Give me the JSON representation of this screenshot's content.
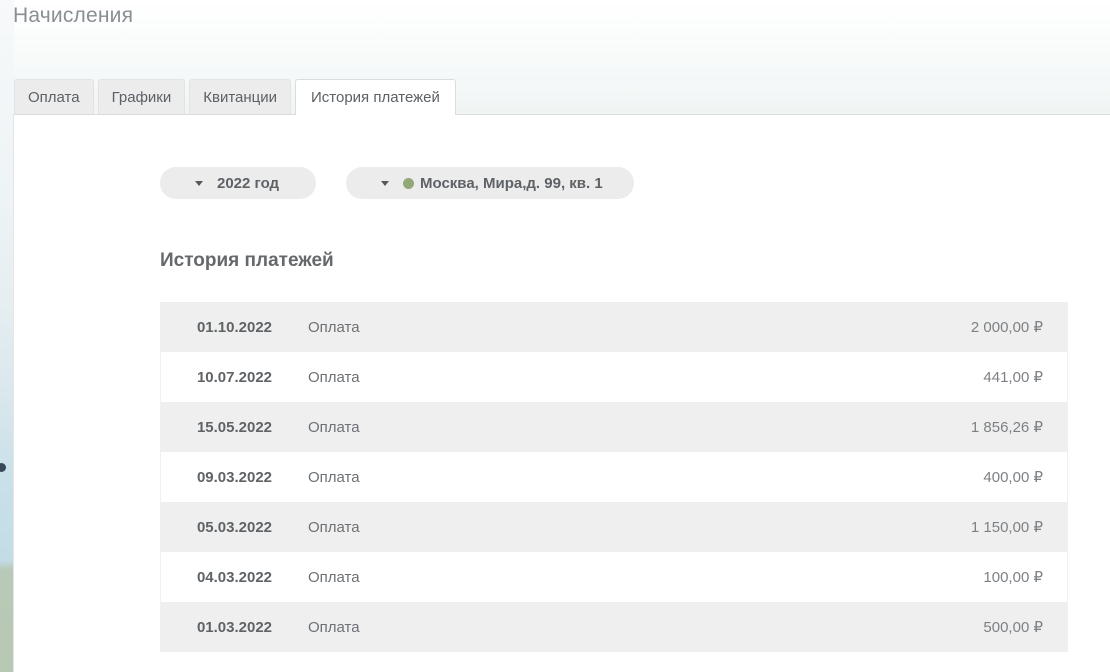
{
  "header": {
    "title": "Начисления"
  },
  "tabs": [
    {
      "label": "Оплата",
      "active": false
    },
    {
      "label": "Графики",
      "active": false
    },
    {
      "label": "Квитанции",
      "active": false
    },
    {
      "label": "История платежей",
      "active": true
    }
  ],
  "filters": {
    "year": "2022 год",
    "address": "Москва, Мира,д. 99, кв. 1",
    "address_status_color": "#93a878"
  },
  "section": {
    "title": "История платежей"
  },
  "payments": [
    {
      "date": "01.10.2022",
      "type": "Оплата",
      "amount": "2 000,00 ₽"
    },
    {
      "date": "10.07.2022",
      "type": "Оплата",
      "amount": "441,00 ₽"
    },
    {
      "date": "15.05.2022",
      "type": "Оплата",
      "amount": "1 856,26 ₽"
    },
    {
      "date": "09.03.2022",
      "type": "Оплата",
      "amount": "400,00 ₽"
    },
    {
      "date": "05.03.2022",
      "type": "Оплата",
      "amount": "1 150,00 ₽"
    },
    {
      "date": "04.03.2022",
      "type": "Оплата",
      "amount": "100,00 ₽"
    },
    {
      "date": "01.03.2022",
      "type": "Оплата",
      "amount": "500,00 ₽"
    }
  ]
}
